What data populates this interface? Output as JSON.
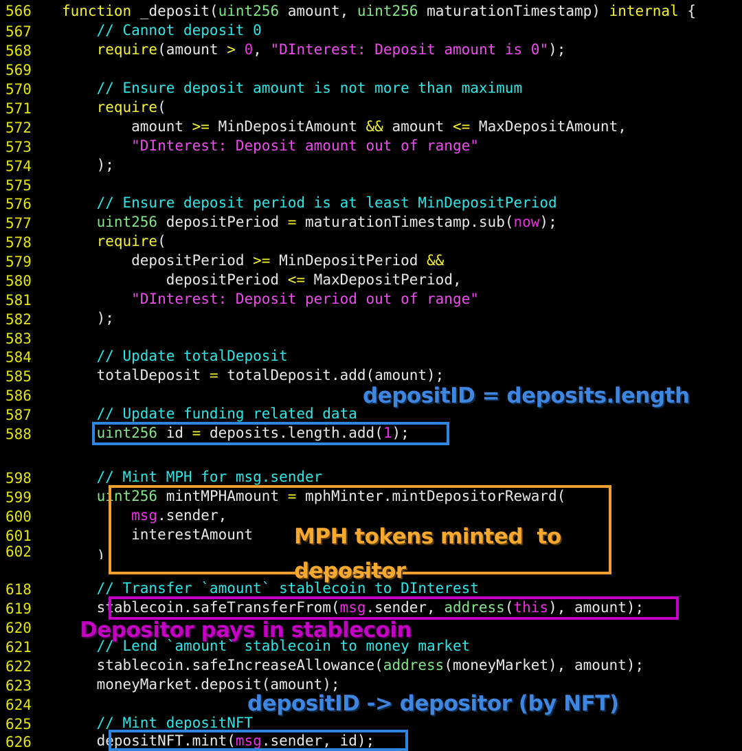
{
  "editor": {
    "background": "#000000",
    "gutter_color": "#e5e509",
    "font_size_px": 21
  },
  "palette": {
    "keyword": "#f5f531",
    "type": "#86e58a",
    "comment": "#2ee6e6",
    "string": "#ee4cee",
    "number": "#ee2ee2",
    "builtin": "#ee2ee2",
    "plain": "#e8e8e8",
    "line_number": "#e5e509",
    "annotation_blue": "#3e86e0",
    "annotation_orange": "#f7a82e",
    "annotation_magenta": "#c400c4",
    "box_blue": "#2f86e0",
    "box_orange": "#f0a030",
    "box_magenta": "#c400c4"
  },
  "code": {
    "language": "solidity",
    "lines": [
      {
        "number": "566",
        "text": "function _deposit(uint256 amount, uint256 maturationTimestamp) internal {"
      },
      {
        "number": "567",
        "text": "    // Cannot deposit 0"
      },
      {
        "number": "568",
        "text": "    require(amount > 0, \"DInterest: Deposit amount is 0\");"
      },
      {
        "number": "569",
        "text": ""
      },
      {
        "number": "570",
        "text": "    // Ensure deposit amount is not more than maximum"
      },
      {
        "number": "571",
        "text": "    require("
      },
      {
        "number": "572",
        "text": "        amount >= MinDepositAmount && amount <= MaxDepositAmount,"
      },
      {
        "number": "573",
        "text": "        \"DInterest: Deposit amount out of range\""
      },
      {
        "number": "574",
        "text": "    );"
      },
      {
        "number": "575",
        "text": ""
      },
      {
        "number": "576",
        "text": "    // Ensure deposit period is at least MinDepositPeriod"
      },
      {
        "number": "577",
        "text": "    uint256 depositPeriod = maturationTimestamp.sub(now);"
      },
      {
        "number": "578",
        "text": "    require("
      },
      {
        "number": "579",
        "text": "        depositPeriod >= MinDepositPeriod &&"
      },
      {
        "number": "580",
        "text": "            depositPeriod <= MaxDepositPeriod,"
      },
      {
        "number": "581",
        "text": "        \"DInterest: Deposit period out of range\""
      },
      {
        "number": "582",
        "text": "    );"
      },
      {
        "number": "583",
        "text": ""
      },
      {
        "number": "584",
        "text": "    // Update totalDeposit"
      },
      {
        "number": "585",
        "text": "    totalDeposit = totalDeposit.add(amount);"
      },
      {
        "number": "586",
        "text": ""
      },
      {
        "number": "587",
        "text": "    // Update funding related data"
      },
      {
        "number": "588",
        "text": "    uint256 id = deposits.length.add(1);"
      },
      {
        "number": "598",
        "text": "    // Mint MPH for msg.sender"
      },
      {
        "number": "599",
        "text": "    uint256 mintMPHAmount = mphMinter.mintDepositorReward("
      },
      {
        "number": "600",
        "text": "        msg.sender,"
      },
      {
        "number": "601",
        "text": "        interestAmount"
      },
      {
        "number": "602",
        "text": "    );"
      },
      {
        "number": "618",
        "text": "    // Transfer `amount` stablecoin to DInterest"
      },
      {
        "number": "619",
        "text": "    stablecoin.safeTransferFrom(msg.sender, address(this), amount);"
      },
      {
        "number": "620",
        "text": ""
      },
      {
        "number": "621",
        "text": "    // Lend `amount` stablecoin to money market"
      },
      {
        "number": "622",
        "text": "    stablecoin.safeIncreaseAllowance(address(moneyMarket), amount);"
      },
      {
        "number": "623",
        "text": "    moneyMarket.deposit(amount);"
      },
      {
        "number": "624",
        "text": ""
      },
      {
        "number": "625",
        "text": "    // Mint depositNFT"
      },
      {
        "number": "626",
        "text": "    depositNFT.mint(msg.sender, id);"
      }
    ]
  },
  "annotations": [
    {
      "id": "anno-deposit-id",
      "text": "depositID = deposits.length",
      "color": "#3e86e0",
      "style": "blue"
    },
    {
      "id": "anno-mph-minted",
      "text_line1": "MPH tokens minted  to",
      "text_line2": "depositor",
      "color": "#f7a82e",
      "style": "orange"
    },
    {
      "id": "anno-depositor-pays",
      "text": "Depositor pays in stablecoin",
      "color": "#c400c4",
      "style": "magenta"
    },
    {
      "id": "anno-nft-mapping",
      "text": "depositID -> depositor (by NFT)",
      "color": "#3e86e0",
      "style": "blue"
    }
  ],
  "highlight_boxes": [
    {
      "id": "box-line-588",
      "color": "#2f86e0",
      "target_line": "588"
    },
    {
      "id": "box-mph-mint-block",
      "color": "#f0a030",
      "target_lines": "599-602"
    },
    {
      "id": "box-line-619",
      "color": "#c400c4",
      "target_line": "619"
    },
    {
      "id": "box-line-626",
      "color": "#2f86e0",
      "target_line": "626"
    }
  ]
}
